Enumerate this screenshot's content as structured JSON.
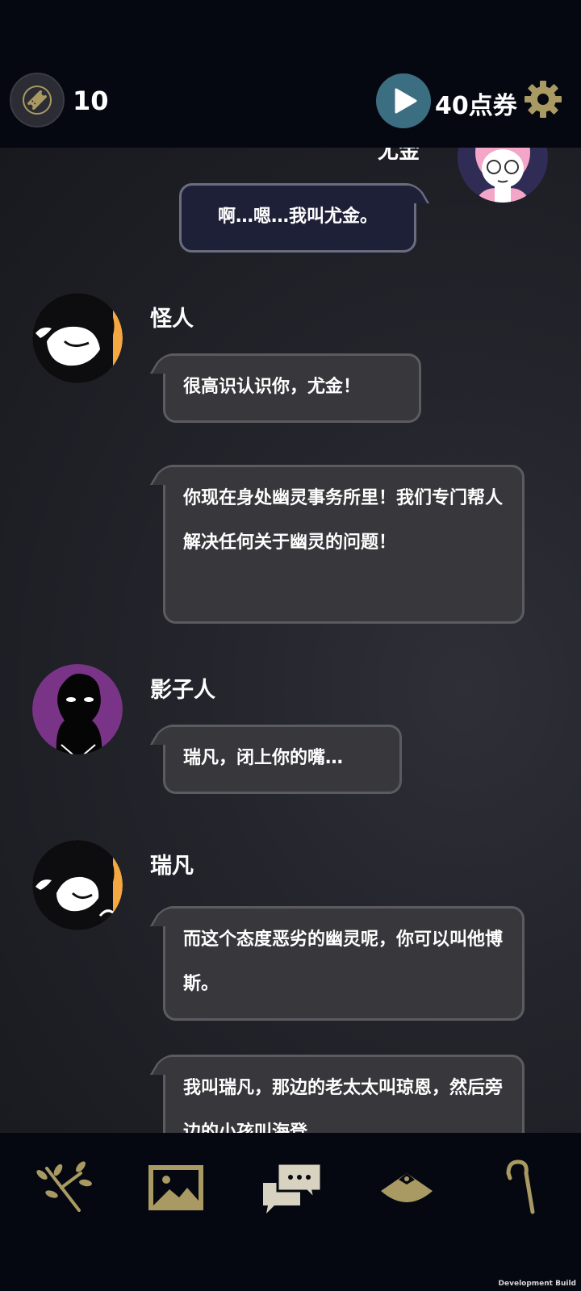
{
  "header": {
    "tickets_count": "10",
    "points_label": "40点券"
  },
  "chat": {
    "self_name_cut": "尤金",
    "messages": [
      {
        "speaker": "self",
        "text": "啊…嗯…我叫尤金。"
      },
      {
        "speaker": "怪人",
        "texts": [
          "很高识认识你，尤金！",
          "你现在身处幽灵事务所里！我们专门帮人解决任何关于幽灵的问题！"
        ]
      },
      {
        "speaker": "影子人",
        "texts": [
          "瑞凡，闭上你的嘴…"
        ]
      },
      {
        "speaker": "瑞凡",
        "texts": [
          "而这个态度恶劣的幽灵呢，你可以叫他博斯。",
          "我叫瑞凡，那边的老太太叫琼恩，然后旁边的小孩叫海登"
        ]
      }
    ]
  },
  "nav": {
    "items": [
      "branch-icon",
      "gallery-icon",
      "chat-icon",
      "hat-icon",
      "cane-icon"
    ],
    "accent": "#a89a62"
  },
  "footer": {
    "build": "Development Build"
  }
}
